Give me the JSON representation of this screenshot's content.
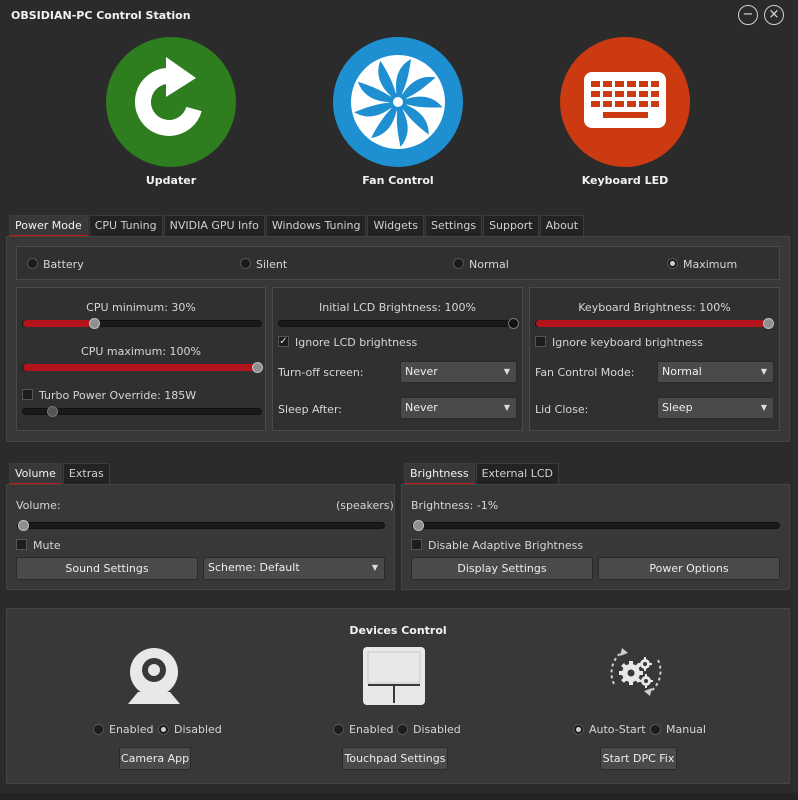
{
  "window": {
    "title": "OBSIDIAN-PC Control Station",
    "minimize_glyph": "−",
    "close_glyph": "×"
  },
  "launchers": [
    {
      "label": "Updater",
      "icon": "refresh-icon",
      "color": "#2e7d1f"
    },
    {
      "label": "Fan Control",
      "icon": "fan-icon",
      "color": "#1e8fd0"
    },
    {
      "label": "Keyboard LED",
      "icon": "keyboard-icon",
      "color": "#cc3a12"
    }
  ],
  "main_tabs": [
    "Power Mode",
    "CPU Tuning",
    "NVIDIA GPU Info",
    "Windows Tuning",
    "Widgets",
    "Settings",
    "Support",
    "About"
  ],
  "power_modes": [
    {
      "label": "Battery",
      "selected": false
    },
    {
      "label": "Silent",
      "selected": false
    },
    {
      "label": "Normal",
      "selected": false
    },
    {
      "label": "Maximum",
      "selected": true
    }
  ],
  "cpu": {
    "min_label": "CPU minimum: 30%",
    "min_value": 0.3,
    "max_label": "CPU maximum: 100%",
    "max_value": 1.0,
    "turbo_label": "Turbo Power Override: 185W",
    "turbo_checked": false,
    "turbo_value": 0.12
  },
  "lcd": {
    "brightness_label": "Initial LCD Brightness: 100%",
    "brightness_value": 1.0,
    "ignore_label": "Ignore LCD brightness",
    "ignore_checked": true,
    "checkmark": "✓",
    "turnoff_label": "Turn-off screen:",
    "turnoff_value": "Never",
    "sleep_label": "Sleep After:",
    "sleep_value": "Never"
  },
  "keyboard": {
    "brightness_label": "Keyboard Brightness: 100%",
    "brightness_value": 1.0,
    "ignore_label": "Ignore keyboard brightness",
    "ignore_checked": false,
    "fan_label": "Fan Control Mode:",
    "fan_value": "Normal",
    "lid_label": "Lid Close:",
    "lid_value": "Sleep"
  },
  "sound_tabs": [
    "Volume",
    "Extras"
  ],
  "volume": {
    "label": "Volume:",
    "device": "(speakers)",
    "value": 0.0,
    "mute_label": "Mute",
    "mute_checked": false,
    "sound_settings": "Sound Settings",
    "scheme": "Scheme: Default"
  },
  "display_tabs": [
    "Brightness",
    "External LCD"
  ],
  "brightness": {
    "label": "Brightness: -1%",
    "value": 0.0,
    "adaptive_label": "Disable Adaptive Brightness",
    "adaptive_checked": false,
    "display_settings": "Display Settings",
    "power_options": "Power Options"
  },
  "devices": {
    "title": "Devices Control",
    "camera": {
      "icon": "webcam-icon",
      "opt1": "Enabled",
      "opt2": "Disabled",
      "selected": "Disabled",
      "button": "Camera App"
    },
    "touchpad": {
      "icon": "touchpad-icon",
      "opt1": "Enabled",
      "opt2": "Disabled",
      "selected": "none",
      "button": "Touchpad Settings"
    },
    "dpc": {
      "icon": "gears-cycle-icon",
      "opt1": "Auto-Start",
      "opt2": "Manual",
      "selected": "Auto-Start",
      "button": "Start DPC Fix"
    }
  },
  "colors": {
    "accent": "#b3141b",
    "background": "#2b2b2b",
    "panel": "#383838"
  }
}
